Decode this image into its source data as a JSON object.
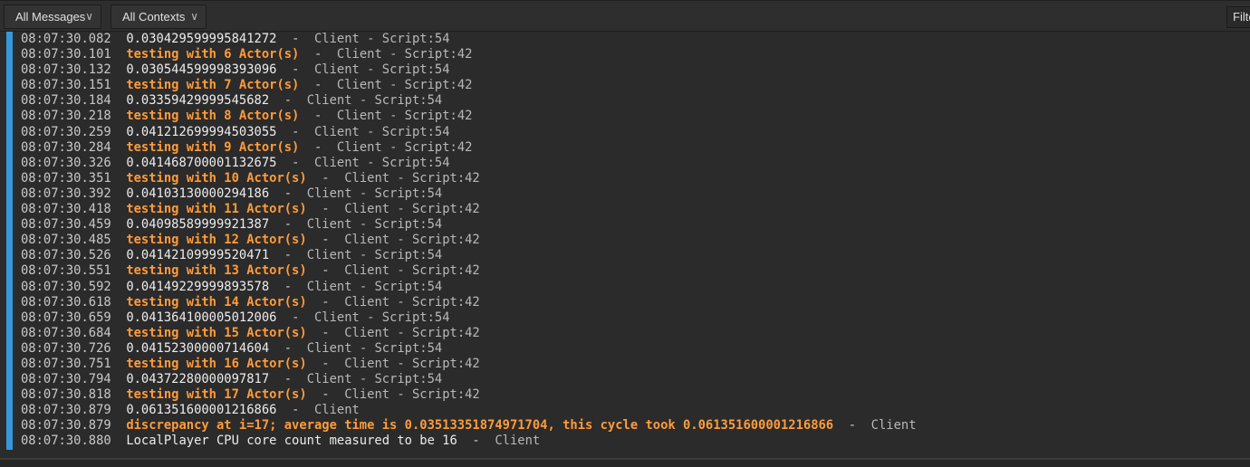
{
  "toolbar": {
    "message_filter": "All Messages",
    "context_filter": "All Contexts",
    "filter_label": "Filter"
  },
  "colors": {
    "warn": "#ff9b3a",
    "accent_bar": "#3498db"
  },
  "rows": [
    {
      "time": "08:07:30.082",
      "msg": "0.030429599995841272",
      "source": "Client - Script:54",
      "warn": false
    },
    {
      "time": "08:07:30.101",
      "msg": "testing with 6 Actor(s)",
      "source": "Client - Script:42",
      "warn": true
    },
    {
      "time": "08:07:30.132",
      "msg": "0.030544599998393096",
      "source": "Client - Script:54",
      "warn": false
    },
    {
      "time": "08:07:30.151",
      "msg": "testing with 7 Actor(s)",
      "source": "Client - Script:42",
      "warn": true
    },
    {
      "time": "08:07:30.184",
      "msg": "0.03359429999545682",
      "source": "Client - Script:54",
      "warn": false
    },
    {
      "time": "08:07:30.218",
      "msg": "testing with 8 Actor(s)",
      "source": "Client - Script:42",
      "warn": true
    },
    {
      "time": "08:07:30.259",
      "msg": "0.041212699994503055",
      "source": "Client - Script:54",
      "warn": false
    },
    {
      "time": "08:07:30.284",
      "msg": "testing with 9 Actor(s)",
      "source": "Client - Script:42",
      "warn": true
    },
    {
      "time": "08:07:30.326",
      "msg": "0.041468700001132675",
      "source": "Client - Script:54",
      "warn": false
    },
    {
      "time": "08:07:30.351",
      "msg": "testing with 10 Actor(s)",
      "source": "Client - Script:42",
      "warn": true
    },
    {
      "time": "08:07:30.392",
      "msg": "0.04103130000294186",
      "source": "Client - Script:54",
      "warn": false
    },
    {
      "time": "08:07:30.418",
      "msg": "testing with 11 Actor(s)",
      "source": "Client - Script:42",
      "warn": true
    },
    {
      "time": "08:07:30.459",
      "msg": "0.04098589999921387",
      "source": "Client - Script:54",
      "warn": false
    },
    {
      "time": "08:07:30.485",
      "msg": "testing with 12 Actor(s)",
      "source": "Client - Script:42",
      "warn": true
    },
    {
      "time": "08:07:30.526",
      "msg": "0.04142109999520471",
      "source": "Client - Script:54",
      "warn": false
    },
    {
      "time": "08:07:30.551",
      "msg": "testing with 13 Actor(s)",
      "source": "Client - Script:42",
      "warn": true
    },
    {
      "time": "08:07:30.592",
      "msg": "0.04149229999893578",
      "source": "Client - Script:54",
      "warn": false
    },
    {
      "time": "08:07:30.618",
      "msg": "testing with 14 Actor(s)",
      "source": "Client - Script:42",
      "warn": true
    },
    {
      "time": "08:07:30.659",
      "msg": "0.041364100005012006",
      "source": "Client - Script:54",
      "warn": false
    },
    {
      "time": "08:07:30.684",
      "msg": "testing with 15 Actor(s)",
      "source": "Client - Script:42",
      "warn": true
    },
    {
      "time": "08:07:30.726",
      "msg": "0.04152300000714604",
      "source": "Client - Script:54",
      "warn": false
    },
    {
      "time": "08:07:30.751",
      "msg": "testing with 16 Actor(s)",
      "source": "Client - Script:42",
      "warn": true
    },
    {
      "time": "08:07:30.794",
      "msg": "0.04372280000097817",
      "source": "Client - Script:54",
      "warn": false
    },
    {
      "time": "08:07:30.818",
      "msg": "testing with 17 Actor(s)",
      "source": "Client - Script:42",
      "warn": true
    },
    {
      "time": "08:07:30.879",
      "msg": "0.061351600001216866",
      "source": "Client",
      "warn": false
    },
    {
      "time": "08:07:30.879",
      "msg": "discrepancy at i=17; average time is 0.03513351874971704, this cycle took 0.061351600001216866",
      "source": "Client",
      "warn": true
    },
    {
      "time": "08:07:30.880",
      "msg": "LocalPlayer CPU core count measured to be 16",
      "source": "Client",
      "warn": false
    }
  ]
}
